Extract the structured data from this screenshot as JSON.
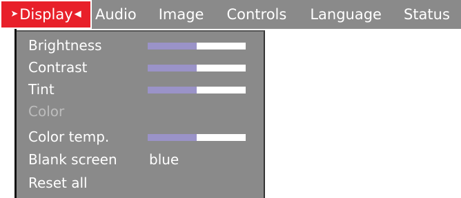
{
  "menu_bar": {
    "tabs": [
      {
        "label": "Display",
        "active": true
      },
      {
        "label": "Audio",
        "active": false
      },
      {
        "label": "Image",
        "active": false
      },
      {
        "label": "Controls",
        "active": false
      },
      {
        "label": "Language",
        "active": false
      },
      {
        "label": "Status",
        "active": false
      }
    ],
    "active_left_arrow": "➤",
    "active_right_arrow": "◀"
  },
  "display_menu": {
    "items": [
      {
        "label": "Brightness",
        "type": "slider",
        "level": 0.5
      },
      {
        "label": "Contrast",
        "type": "slider",
        "level": 0.5
      },
      {
        "label": "Tint",
        "type": "slider",
        "level": 0.5
      },
      {
        "label": "Color",
        "type": "disabled"
      },
      {
        "label": "Color temp.",
        "type": "slider",
        "level": 0.5
      },
      {
        "label": "Blank screen",
        "type": "value",
        "value": "blue"
      },
      {
        "label": "Reset all",
        "type": "action"
      }
    ]
  },
  "colors": {
    "menu_background": "#8a8a8a",
    "active_tab": "#e8202a",
    "slider_fill": "#9a93c8",
    "slider_track": "#ffffff",
    "disabled_text": "#bdbdbd"
  }
}
